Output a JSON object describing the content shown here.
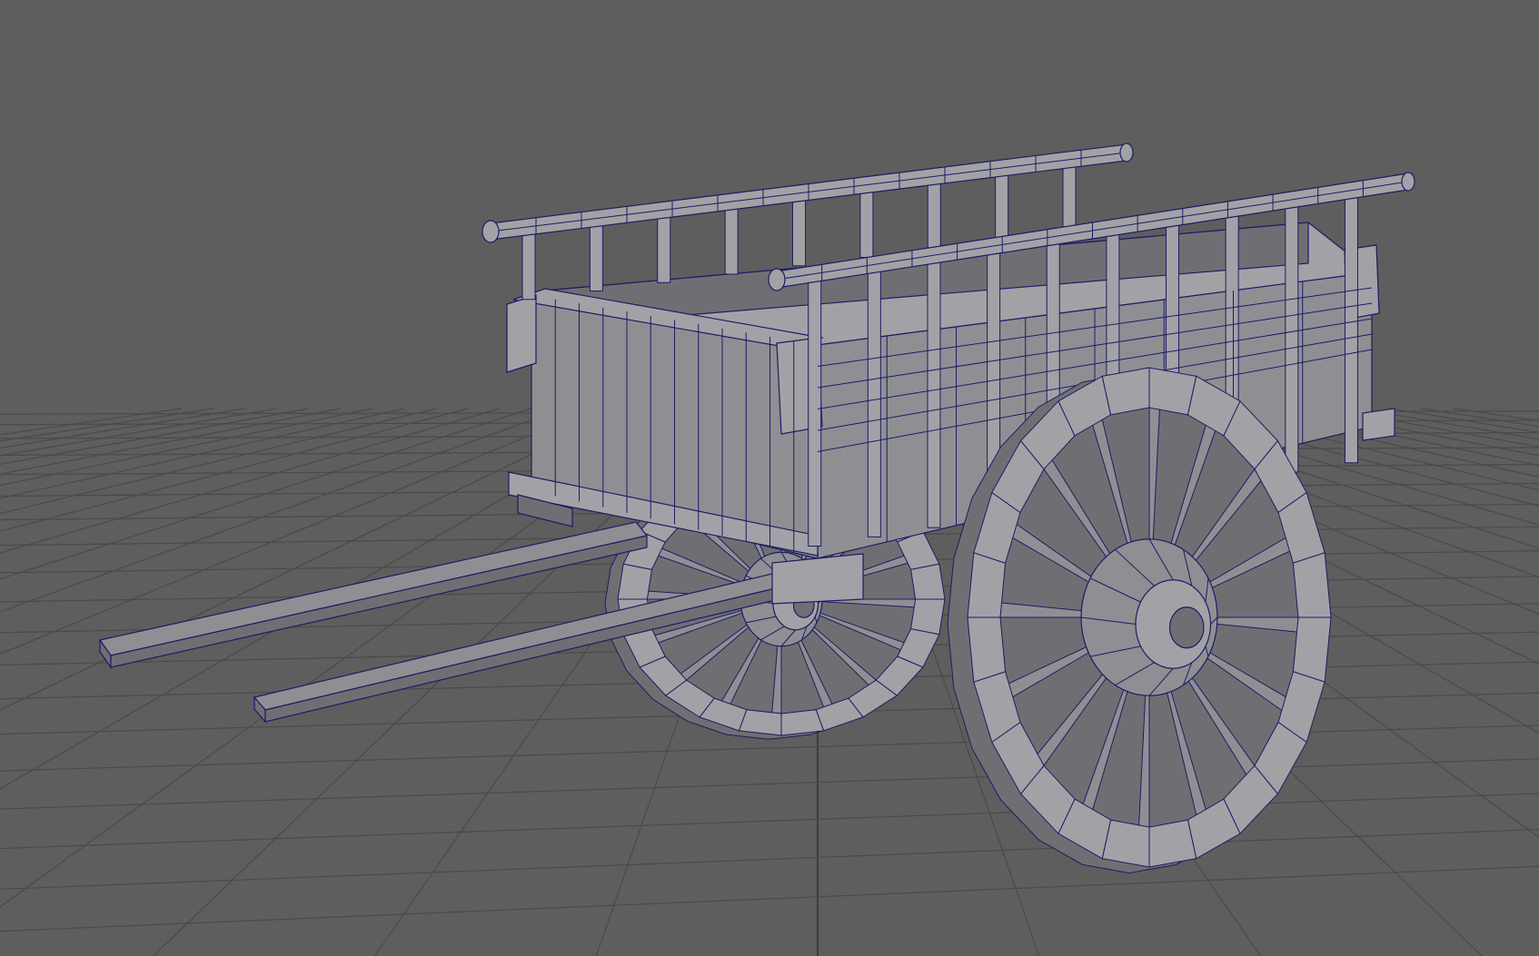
{
  "viewport": {
    "background": "#5e5e5e",
    "grid_color": "#4a4a4a",
    "grid_axis_color": "#3c3c3c",
    "wire_color": "#1c1c66",
    "mesh_fill": "#8f8f93",
    "mesh_fill_light": "#a2a2a6",
    "mesh_fill_dark": "#6f6f73",
    "display_mode": "wireframe-on-shaded",
    "object": "cart"
  }
}
